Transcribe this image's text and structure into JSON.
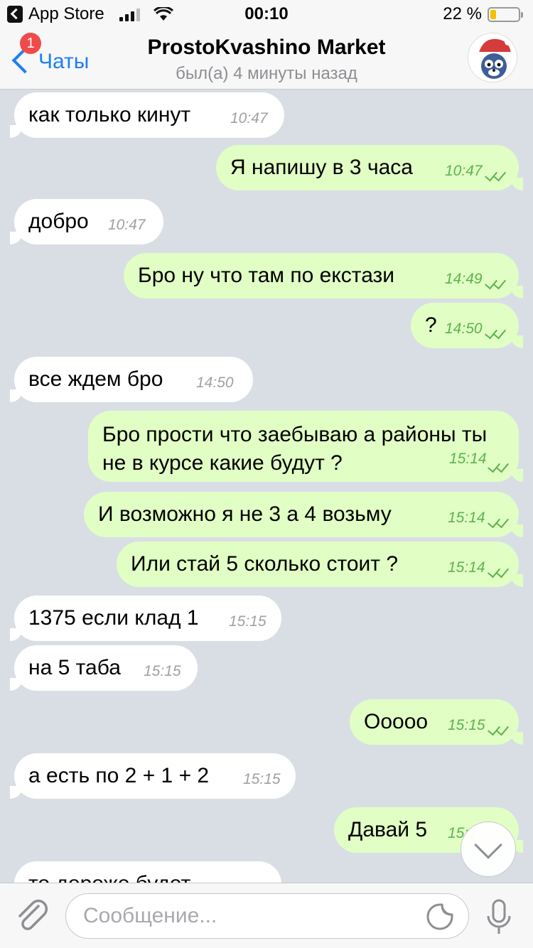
{
  "status_bar": {
    "back_app": "App Store",
    "time": "00:10",
    "battery_percent": "22 %",
    "battery_level": 0.22
  },
  "header": {
    "back_label": "Чаты",
    "unread_badge": "1",
    "title": "ProstoKvashino Market",
    "subtitle": "был(а) 4 минуты назад",
    "avatar_icon": "cat-avatar-icon"
  },
  "messages": [
    {
      "dir": "in",
      "text": "как только кинут",
      "time": "10:47"
    },
    {
      "dir": "out",
      "text": "Я напишу в 3 часа",
      "time": "10:47",
      "read": true
    },
    {
      "dir": "in",
      "text": "добро",
      "time": "10:47"
    },
    {
      "dir": "out",
      "text": "Бро ну что там по екстази",
      "time": "14:49",
      "read": true
    },
    {
      "dir": "out",
      "text": "?",
      "time": "14:50",
      "read": true
    },
    {
      "dir": "in",
      "text": "все ждем бро",
      "time": "14:50"
    },
    {
      "dir": "out",
      "text": "Бро прости что заебываю а районы ты не в курсе какие будут ?",
      "time": "15:14",
      "read": true
    },
    {
      "dir": "out",
      "text": "И возможно я не 3 а 4 возьму",
      "time": "15:14",
      "read": true
    },
    {
      "dir": "out",
      "text": "Или стай 5 сколько стоит ?",
      "time": "15:14",
      "read": true
    },
    {
      "dir": "in",
      "text": "1375 если клад 1",
      "time": "15:15"
    },
    {
      "dir": "in",
      "text": "на 5 таба",
      "time": "15:15"
    },
    {
      "dir": "out",
      "text": "Ооооо",
      "time": "15:15",
      "read": true
    },
    {
      "dir": "in",
      "text": "а есть по 2 + 1 + 2",
      "time": "15:15"
    },
    {
      "dir": "out",
      "text": "Давай 5",
      "time": "15:1",
      "read": true
    },
    {
      "dir": "in",
      "text": "то дороже будет",
      "time": ""
    }
  ],
  "input": {
    "placeholder": "Сообщение..."
  },
  "colors": {
    "accent": "#1f7ef6",
    "outgoing_bubble": "#e1fec5",
    "incoming_bubble": "#ffffff",
    "chat_background": "#d9dee5",
    "badge": "#f04b4b",
    "read_check": "#5cb34d"
  }
}
